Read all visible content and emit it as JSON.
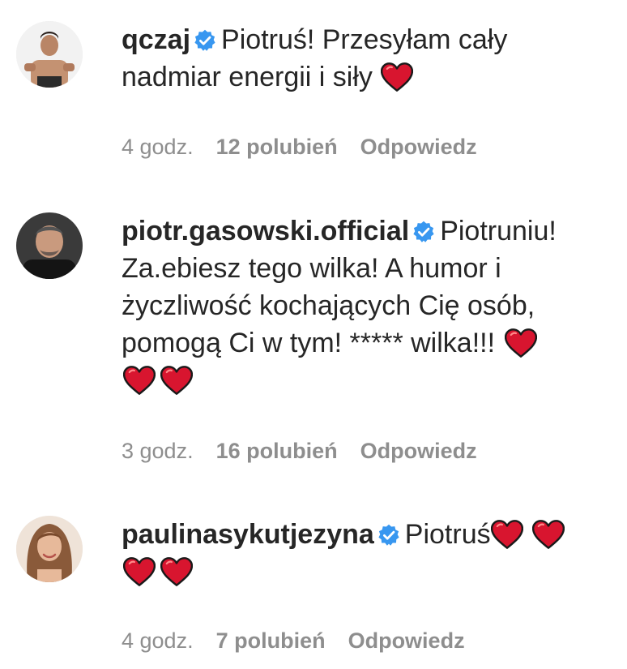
{
  "comments": [
    {
      "username": "qczaj",
      "text": "Piotruś! Przesyłam cały nadmiar energii i siły",
      "hearts_after_text": 1,
      "time": "4 godz.",
      "likes": "12 polubień",
      "reply": "Odpowiedz"
    },
    {
      "username": "piotr.gasowski.official",
      "text_line1": "Piotruniu!",
      "text_line2": "Za.ebiesz tego wilka! A humor i",
      "text_line3": "życzliwość kochających Cię osób,",
      "text_line4": "pomogą Ci w tym! ***** wilka!!!",
      "time": "3 godz.",
      "likes": "16 polubień",
      "reply": "Odpowiedz"
    },
    {
      "username": "paulinasykutjezyna",
      "text": "Piotruś",
      "time": "4 godz.",
      "likes": "7 polubień",
      "reply": "Odpowiedz"
    }
  ],
  "colors": {
    "verified": "#3897f0",
    "heart": "#e0245e",
    "meta": "#8e8e8e",
    "text": "#262626"
  },
  "icons": {
    "verified": "verified-badge-icon",
    "heart": "red-heart-emoji"
  }
}
